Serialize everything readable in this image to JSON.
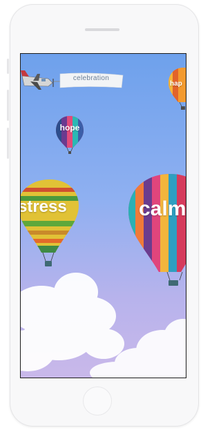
{
  "app": {
    "plane_banner": "celebration",
    "balloons": [
      {
        "label": "hope"
      },
      {
        "label": "stress"
      },
      {
        "label": "calm"
      },
      {
        "label": "hap"
      }
    ]
  },
  "colors": {
    "sky_top": "#6ea1ec",
    "sky_bottom": "#c9b8ea",
    "device_frame": "#f8f8f9"
  }
}
